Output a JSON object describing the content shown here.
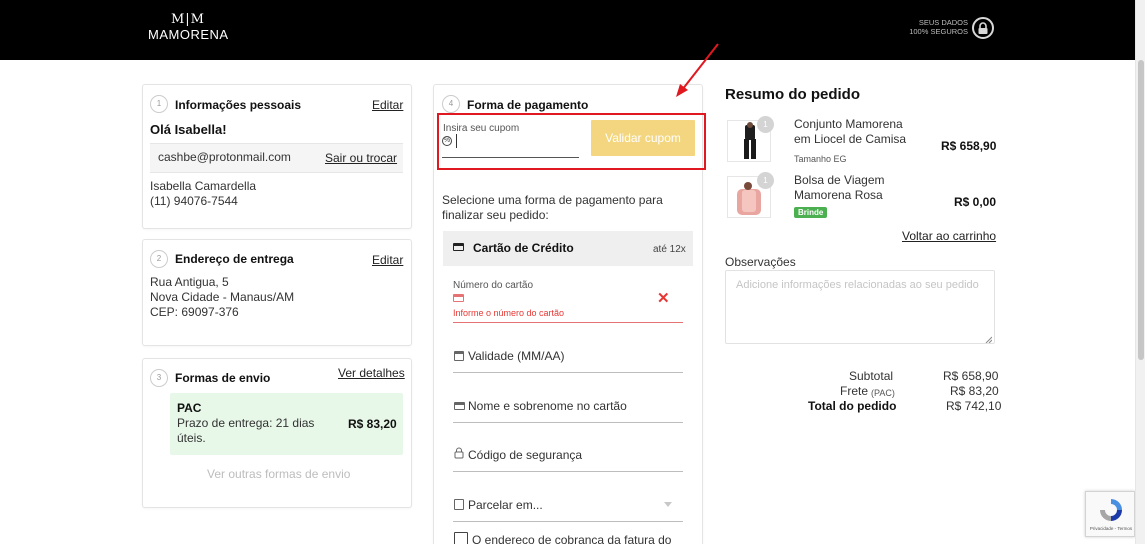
{
  "header": {
    "logo_mark": "M|M",
    "logo_text": "MAMORENA",
    "secure_line1": "SEUS DADOS",
    "secure_line2": "100% SEGUROS"
  },
  "personal": {
    "step": "1",
    "title": "Informações pessoais",
    "edit": "Editar",
    "greeting": "Olá Isabella!",
    "email": "cashbe@protonmail.com",
    "switch": "Sair ou trocar",
    "name": "Isabella Camardella",
    "phone": "(11) 94076-7544"
  },
  "address": {
    "step": "2",
    "title": "Endereço de entrega",
    "edit": "Editar",
    "line1": "Rua Antigua, 5",
    "line2": "Nova Cidade - Manaus/AM",
    "line3": "CEP: 69097-376"
  },
  "shipping": {
    "step": "3",
    "title": "Formas de envio",
    "details": "Ver detalhes",
    "method": "PAC",
    "deadline_line1": "Prazo de entrega: 21 dias",
    "deadline_line2": "úteis.",
    "price": "R$ 83,20",
    "other": "Ver outras formas de envio"
  },
  "payment": {
    "step": "4",
    "title": "Forma de pagamento",
    "coupon_label": "Insira seu cupom",
    "coupon_button": "Validar cupom",
    "instruction_line1": "Selecione uma forma de pagamento para",
    "instruction_line2": "finalizar seu pedido:",
    "credit_card": "Cartão de Crédito",
    "installments_note": "até 12x",
    "card_number_label": "Número do cartão",
    "card_number_error": "Informe o número do cartão",
    "validity": "Validade (MM/AA)",
    "holder": "Nome e sobrenome no cartão",
    "security_code": "Código de segurança",
    "installments": "Parcelar em...",
    "billing_address": "O endereço de cobrança da fatura do"
  },
  "summary": {
    "title": "Resumo do pedido",
    "items": [
      {
        "qty": "1",
        "name_line1": "Conjunto Mamorena",
        "name_line2": "em Liocel de Camisa",
        "variant": "Tamanho EG",
        "price": "R$ 658,90"
      },
      {
        "qty": "1",
        "name_line1": "Bolsa de Viagem",
        "name_line2": "Mamorena Rosa",
        "badge": "Brinde",
        "price": "R$ 0,00"
      }
    ],
    "back_to_cart": "Voltar ao carrinho",
    "notes_label": "Observações",
    "notes_placeholder": "Adicione informações relacionadas ao seu pedido",
    "subtotal_label": "Subtotal",
    "subtotal": "R$ 658,90",
    "shipping_label": "Frete",
    "shipping_method": "(PAC)",
    "shipping": "R$ 83,20",
    "total_label": "Total do pedido",
    "total": "R$ 742,10"
  },
  "recaptcha": {
    "text": "Privacidade - Termos"
  },
  "colors": {
    "accent_yellow": "#f3d67f",
    "error_red": "#e0181f",
    "badge_green": "#4caf50"
  }
}
